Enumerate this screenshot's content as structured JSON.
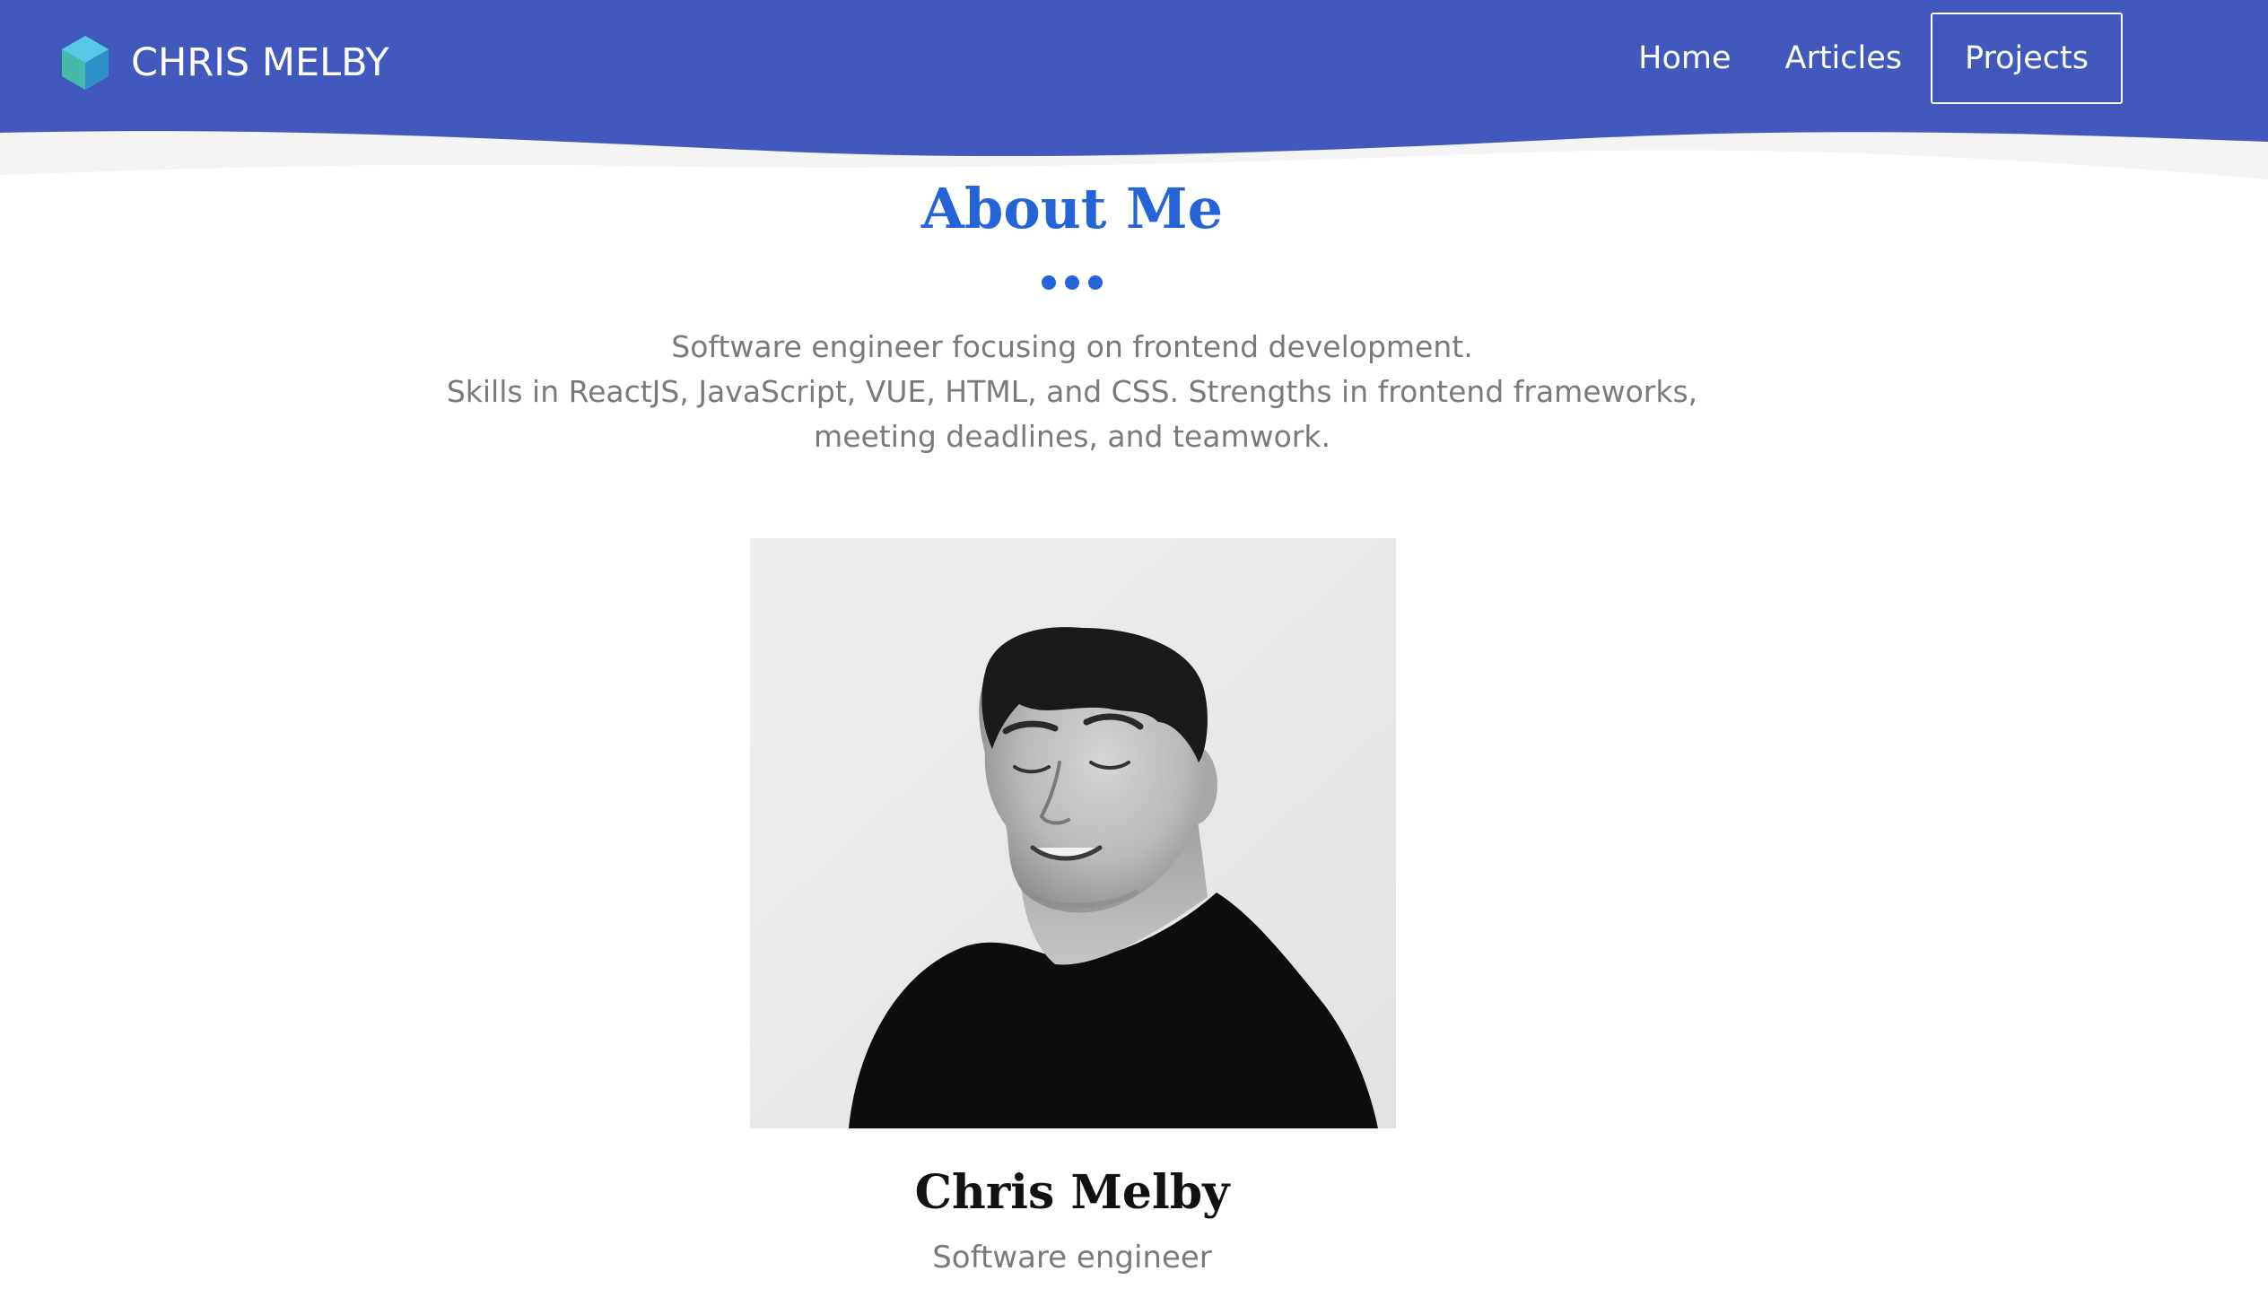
{
  "colors": {
    "header_bg": "#4159bd",
    "accent": "#2463d8",
    "body_text": "#7a7a7a",
    "wave_light": "#f4f4f4"
  },
  "brand": {
    "logo_icon": "hexagon-logo-icon",
    "name": "CHRIS MELBY"
  },
  "nav": {
    "items": [
      {
        "label": "Home"
      },
      {
        "label": "Articles"
      },
      {
        "label": "Projects"
      }
    ],
    "active": "Projects"
  },
  "about": {
    "title": "About Me",
    "bio_lines": [
      "Software engineer focusing on frontend development.",
      "Skills in ReactJS, JavaScript, VUE, HTML, and CSS. Strengths in frontend frameworks,",
      "meeting deadlines, and teamwork."
    ]
  },
  "profile": {
    "photo_icon": "portrait-photo",
    "name": "Chris Melby",
    "role": "Software engineer"
  }
}
